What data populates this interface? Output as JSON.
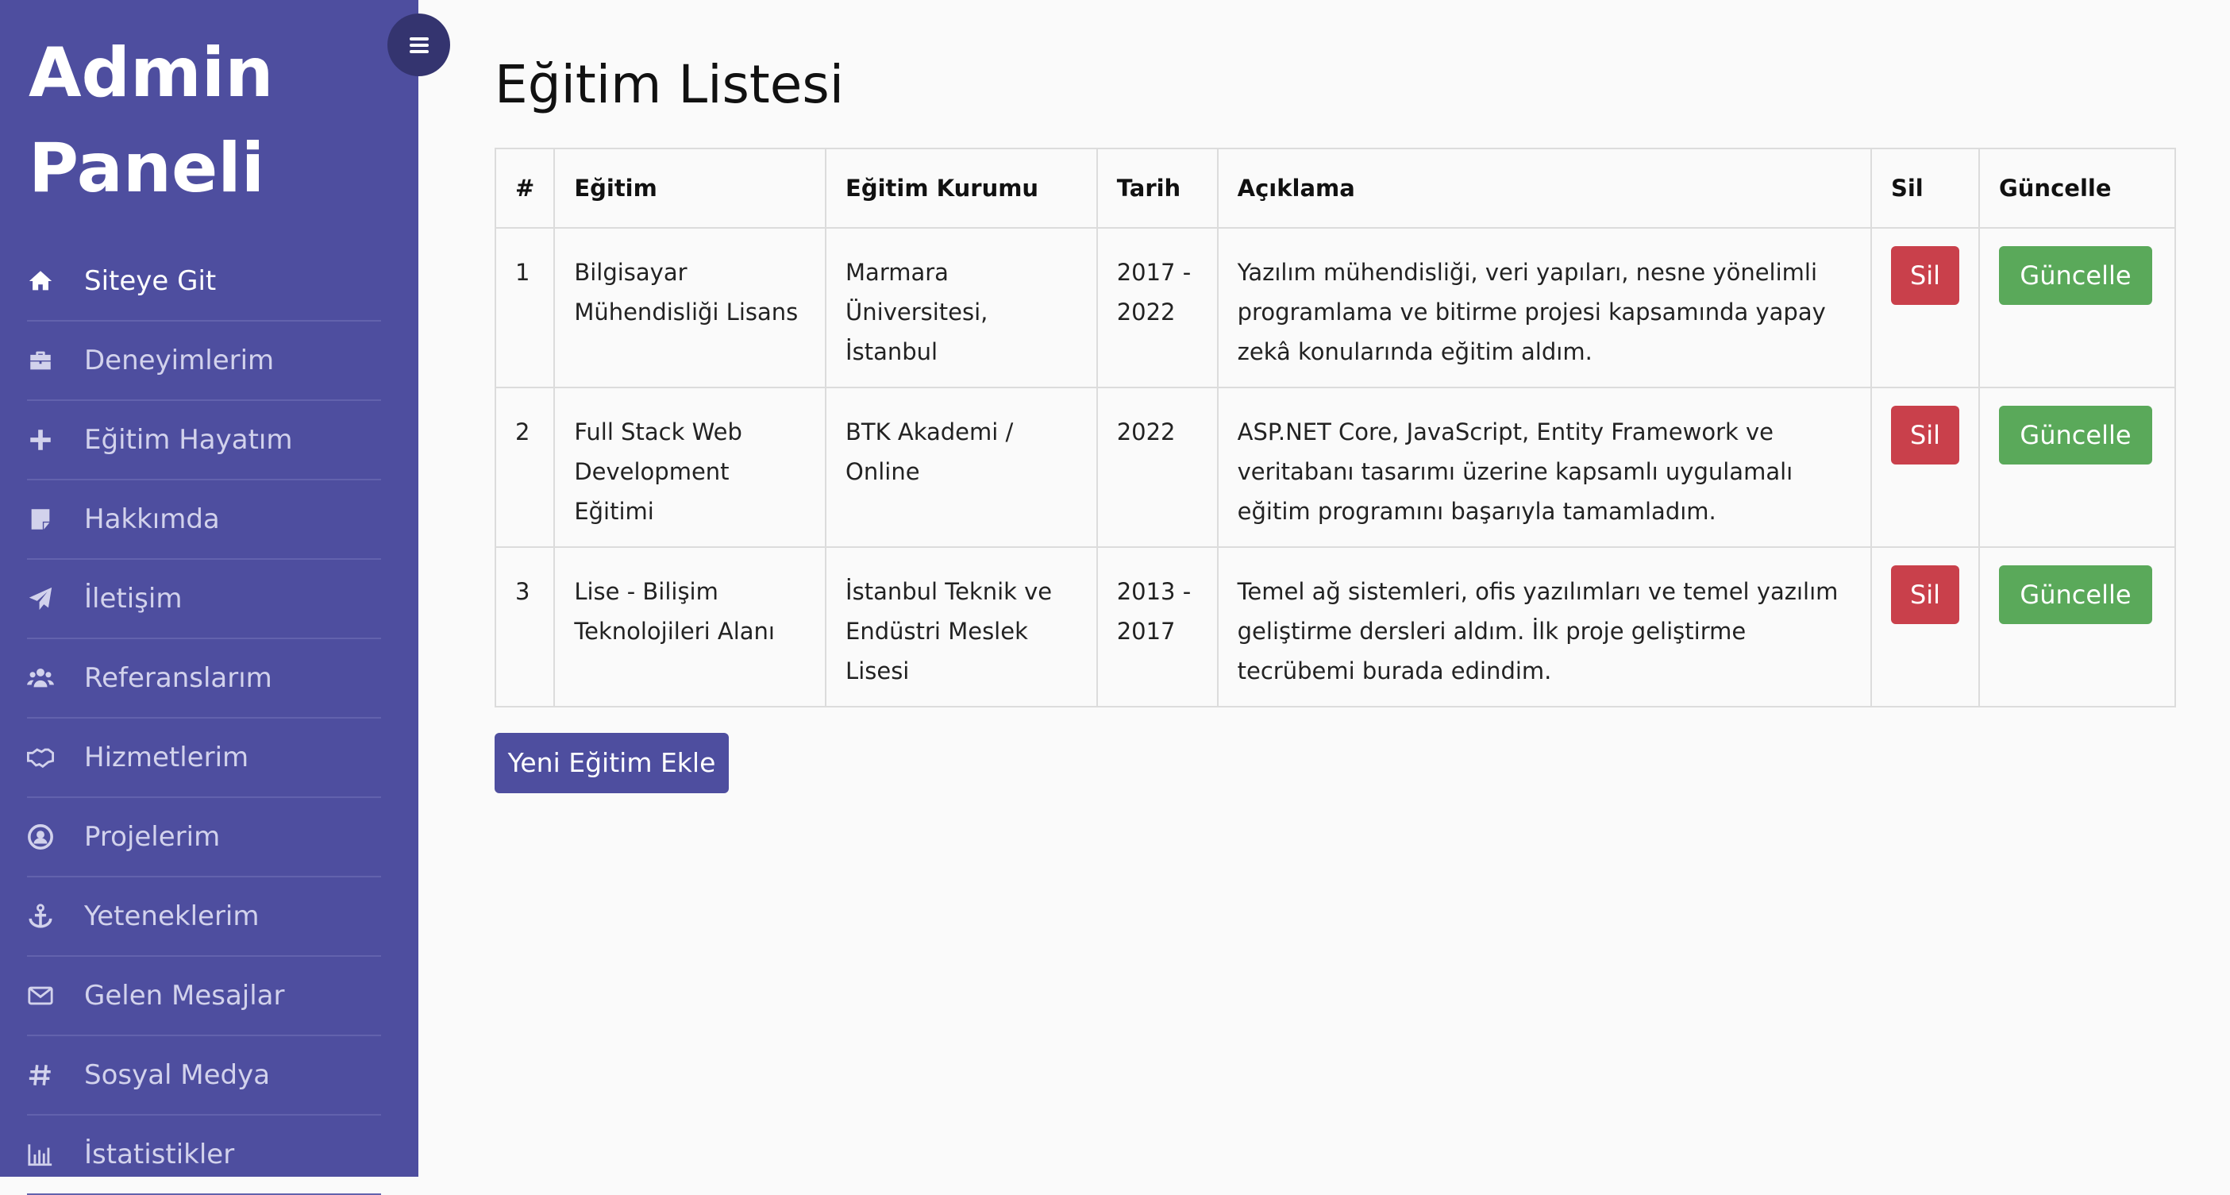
{
  "sidebar": {
    "brand_line1": "Admin",
    "brand_line2": "Paneli",
    "items": [
      {
        "label": "Siteye Git",
        "icon": "home-icon"
      },
      {
        "label": "Deneyimlerim",
        "icon": "briefcase-icon"
      },
      {
        "label": "Eğitim Hayatım",
        "icon": "plus-icon"
      },
      {
        "label": "Hakkımda",
        "icon": "sticky-note-icon"
      },
      {
        "label": "İletişim",
        "icon": "paper-plane-icon"
      },
      {
        "label": "Referanslarım",
        "icon": "users-icon"
      },
      {
        "label": "Hizmetlerim",
        "icon": "handshake-icon"
      },
      {
        "label": "Projelerim",
        "icon": "user-circle-icon"
      },
      {
        "label": "Yeteneklerim",
        "icon": "anchor-icon"
      },
      {
        "label": "Gelen Mesajlar",
        "icon": "envelope-icon"
      },
      {
        "label": "Sosyal Medya",
        "icon": "hashtag-icon"
      },
      {
        "label": "İstatistikler",
        "icon": "bar-chart-icon"
      }
    ]
  },
  "main": {
    "title": "Eğitim Listesi",
    "table": {
      "headers": [
        "#",
        "Eğitim",
        "Eğitim Kurumu",
        "Tarih",
        "Açıklama",
        "Sil",
        "Güncelle"
      ],
      "rows": [
        {
          "no": "1",
          "egitim": "Bilgisayar Mühendisliği Lisans",
          "kurum": "Marmara Üniversitesi, İstanbul",
          "tarih": "2017 - 2022",
          "aciklama": "Yazılım mühendisliği, veri yapıları, nesne yönelimli programlama ve bitirme projesi kapsamında yapay zekâ konularında eğitim aldım."
        },
        {
          "no": "2",
          "egitim": "Full Stack Web Development Eğitimi",
          "kurum": "BTK Akademi / Online",
          "tarih": "2022",
          "aciklama": "ASP.NET Core, JavaScript, Entity Framework ve veritabanı tasarımı üzerine kapsamlı uygulamalı eğitim programını başarıyla tamamladım."
        },
        {
          "no": "3",
          "egitim": "Lise - Bilişim Teknolojileri Alanı",
          "kurum": "İstanbul Teknik ve Endüstri Meslek Lisesi",
          "tarih": "2013 - 2017",
          "aciklama": "Temel ağ sistemleri, ofis yazılımları ve temel yazılım geliştirme dersleri aldım. İlk proje geliştirme tecrübemi burada edindim."
        }
      ],
      "delete_label": "Sil",
      "update_label": "Güncelle"
    },
    "add_button": "Yeni Eğitim Ekle"
  },
  "colors": {
    "sidebar_bg": "#4e4e9f",
    "toggle_bg": "#34346f",
    "delete_btn": "#c9404b",
    "update_btn": "#5aa95a",
    "add_btn": "#4e4e9f"
  }
}
